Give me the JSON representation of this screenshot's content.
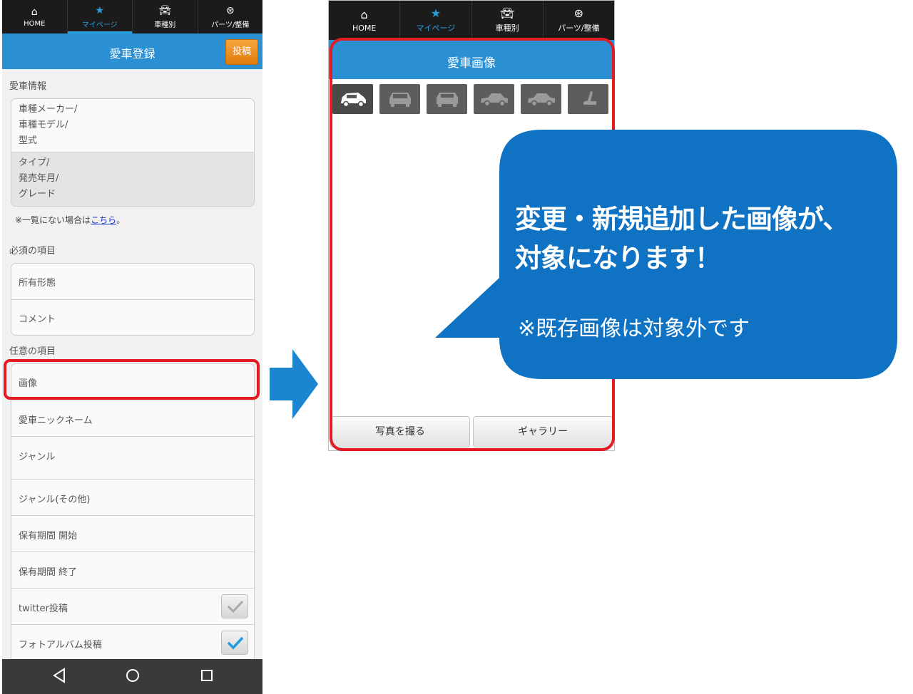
{
  "nav": {
    "home": "HOME",
    "mypage": "マイページ",
    "cartype": "車種別",
    "parts": "パーツ/整備"
  },
  "left": {
    "title": "愛車登録",
    "post_button": "投稿",
    "car_info_label": "愛車情報",
    "car_info_rows": [
      {
        "lines": [
          "車種メーカー/",
          "車種モデル/",
          "型式"
        ]
      },
      {
        "lines": [
          "タイプ/",
          "発売年月/",
          "グレード"
        ]
      }
    ],
    "note_prefix": "※一覧にない場合は",
    "note_link": "こちら",
    "note_suffix": "。",
    "required_label": "必須の項目",
    "required_items": [
      "所有形態",
      "コメント"
    ],
    "optional_label": "任意の項目",
    "optional_items": [
      "画像",
      "愛車ニックネーム",
      "ジャンル",
      "ジャンル(その他)",
      "保有期間 開始",
      "保有期間 終了",
      "twitter投稿",
      "フォトアルバム投稿"
    ],
    "twitter_checked": false,
    "photoalbum_checked": true
  },
  "right": {
    "title": "愛車画像",
    "thumbnails": [
      "car-front-angle",
      "car-front",
      "car-rear",
      "car-side",
      "car-side-2",
      "car-seat"
    ],
    "take_photo_button": "写真を撮る",
    "gallery_button": "ギャラリー"
  },
  "callout": {
    "line1": "変更・新規追加した画像が、",
    "line2": "対象になります！",
    "sub": "※既存画像は対象外です"
  },
  "colors": {
    "accent_blue": "#2b8fd4",
    "highlight_red": "#e31b23",
    "bubble_blue": "#0f72c2",
    "post_orange": "#f29a2e"
  }
}
